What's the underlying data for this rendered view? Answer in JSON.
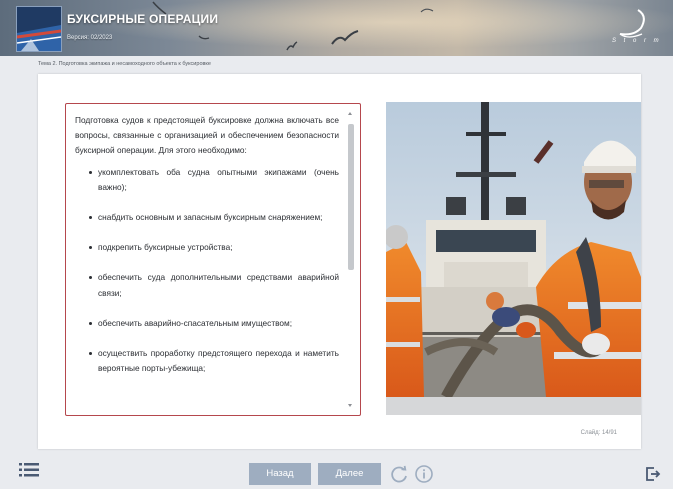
{
  "header": {
    "title": "БУКСИРНЫЕ ОПЕРАЦИИ",
    "version": "Версия: 02/2023",
    "brand": "S t o r m",
    "logo_icon": "ship-logo-icon"
  },
  "breadcrumb": "Тема 2. Подготовка экипажа и несамоходного объекта к буксировке",
  "content": {
    "intro": "Подготовка судов к предстоящей буксировке должна включать все вопросы, связанные с организацией и обеспечением безопасности буксирной операции. Для этого необходимо:",
    "items": [
      "укомплектовать оба судна опытными экипажами (очень важно);",
      "снабдить основным и запасным буксирным снаряжением;",
      "подкрепить буксирные устройства;",
      "обеспечить суда дополнительными средствами аварийной связи;",
      "обеспечить аварийно-спасательным имуществом;",
      "осуществить проработку предстоящего перехода и наметить вероятные порты-убежища;"
    ]
  },
  "slide_counter": "Слайд: 14/91",
  "nav": {
    "back_label": "Назад",
    "next_label": "Далее",
    "button_color": "#9eadc0"
  },
  "icons": {
    "menu": "menu-list-icon",
    "reload": "reload-icon",
    "info": "info-icon",
    "exit": "exit-icon"
  },
  "colors": {
    "accent_border": "#b5474d",
    "page_background": "#e9ebef"
  }
}
